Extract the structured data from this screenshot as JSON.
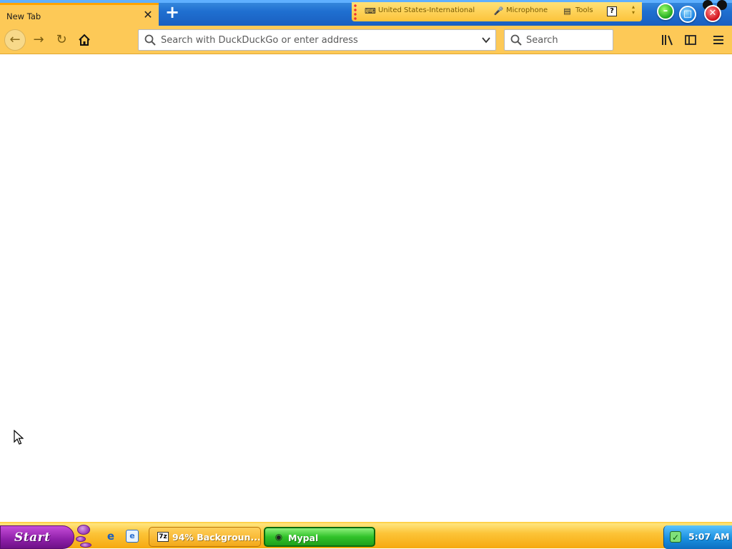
{
  "browser": {
    "tab": {
      "title": "New Tab",
      "close": "✕"
    },
    "new_tab": "+",
    "url_placeholder": "Search with DuckDuckGo or enter address",
    "search_placeholder": "Search",
    "icons": {
      "back": "arrow-left-icon",
      "forward": "arrow-right-icon",
      "reload": "reload-icon",
      "home": "home-icon",
      "library": "library-icon",
      "sidebar": "sidebar-icon",
      "menu": "hamburger-menu-icon"
    }
  },
  "language_bar": {
    "keyboard": "United States-International",
    "microphone": "Microphone",
    "tools": "Tools",
    "help": "?"
  },
  "taskbar": {
    "start": "Start",
    "tasks": [
      {
        "label": "94% Backgroun...",
        "icon": "7z"
      },
      {
        "label": "Mypal"
      }
    ],
    "clock": "5:07 AM"
  },
  "colors": {
    "toolbar": "#fdc957",
    "tabstrip": "#1f6fd0",
    "start_button": "#8d1fa8",
    "active_task": "#31c22a"
  }
}
